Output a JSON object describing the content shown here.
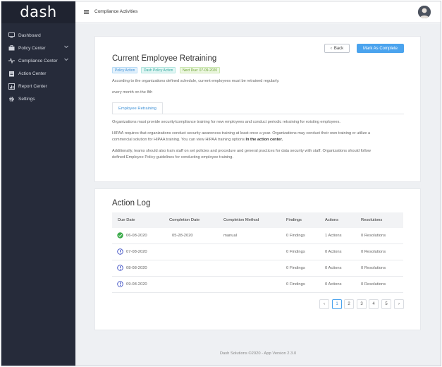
{
  "app": {
    "logo": "dash"
  },
  "sidebar": {
    "items": [
      {
        "label": "Dashboard",
        "icon": "monitor-icon"
      },
      {
        "label": "Policy Center",
        "icon": "briefcase-icon",
        "chevron": true
      },
      {
        "label": "Compliance Center",
        "icon": "pulse-icon",
        "chevron": true
      },
      {
        "label": "Action Center",
        "icon": "clipboard-icon"
      },
      {
        "label": "Report Center",
        "icon": "report-icon"
      },
      {
        "label": "Settings",
        "icon": "gear-icon"
      }
    ]
  },
  "topbar": {
    "title": "Compliance Activities"
  },
  "activity": {
    "title": "Current Employee Retraining",
    "back_label": "Back",
    "complete_label": "Mark As Complete",
    "badges": [
      "Policy Action",
      "Dash Policy Action",
      "Next Due: 07-09-2020"
    ],
    "description": "According to the organizations defined schedule, current employees must be retrained regularly.",
    "schedule": "every month on the 8th",
    "tab_label": "Employee Retraining",
    "para1": "Organizations must provide security/compliance training for new employees and conduct periodic retraining for existing employees.",
    "para2_a": "HIPAA requires that organizations conduct security awareness training at least once a year. Organizations may conduct their own training or utilize a",
    "para2_b": "commercial solution for HIPAA training. You can view HIPAA training options ",
    "para2_bold": "In the action center.",
    "para3_a": "Additionally, teams should also train staff on set policies and procedure and general practices for data security with staff. Organizations should follow",
    "para3_b": "defined Employee Policy guidelines for conducting employee training."
  },
  "action_log": {
    "title": "Action Log",
    "columns": [
      "Due Date",
      "Completion Date",
      "Completion Method",
      "Findings",
      "Actions",
      "Resolutions"
    ],
    "rows": [
      {
        "status": "complete",
        "due": "06-08-2020",
        "completion": "05-28-2020",
        "method": "manual",
        "findings": "0 Findings",
        "actions": "1 Actions",
        "resolutions": "0 Resolutions"
      },
      {
        "status": "pending",
        "due": "07-08-2020",
        "completion": "",
        "method": "",
        "findings": "0 Findings",
        "actions": "0 Actions",
        "resolutions": "0 Resolutions"
      },
      {
        "status": "pending",
        "due": "08-08-2020",
        "completion": "",
        "method": "",
        "findings": "0 Findings",
        "actions": "0 Actions",
        "resolutions": "0 Resolutions"
      },
      {
        "status": "pending",
        "due": "09-08-2020",
        "completion": "",
        "method": "",
        "findings": "0 Findings",
        "actions": "0 Actions",
        "resolutions": "0 Resolutions"
      }
    ],
    "pages": [
      "1",
      "2",
      "3",
      "4",
      "5"
    ],
    "prev": "‹",
    "next": "›"
  },
  "footer": {
    "text": "Dash Solutions ©2020 - App Version 2.3.0"
  },
  "colors": {
    "sidebar": "#262b3a",
    "accent": "#4aa3ee",
    "success": "#3bab4a",
    "info": "#3d4fc4"
  }
}
